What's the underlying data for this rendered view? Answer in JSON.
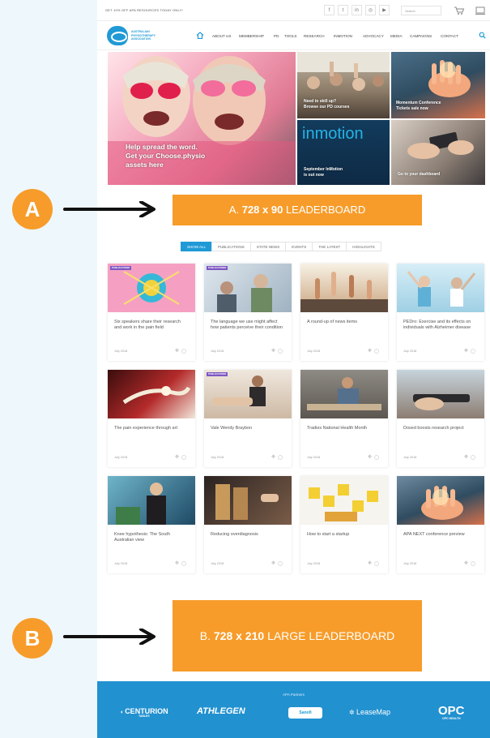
{
  "topbar": {
    "text": "GET 10% OFF APA RESOURCES TODAY ONLY!",
    "search_placeholder": "Search",
    "social_icons": [
      "facebook-icon",
      "twitter-icon",
      "linkedin-icon",
      "instagram-icon",
      "youtube-icon"
    ]
  },
  "nav": {
    "logo_text": "AUSTRALIAN PHYSIOTHERAPY ASSOCIATION",
    "items": [
      "ABOUT US",
      "MEMBERSHIP",
      "PD",
      "TOOLS",
      "RESEARCH",
      "INMOTION",
      "ADVOCACY",
      "MEDIA",
      "CAMPAIGNS",
      "CONTACT"
    ]
  },
  "hero": {
    "main_caption": "Help spread the word.\nGet your Choose.physio\nassets here",
    "tile1": "Need to skill up?\nBrowse our PD courses",
    "tile2": "Momentum Conference\nTickets sale now",
    "tile3_brand": "inmotion",
    "tile3": "September InMotion\nis out now",
    "tile4": "Go to your dashboard"
  },
  "ads": {
    "a_prefix": "A.",
    "a_size": "728 x 90",
    "a_label": "LEADERBOARD",
    "b_prefix": "B.",
    "b_size": "728 x 210",
    "b_label": "LARGE LEADERBOARD"
  },
  "filters": [
    "SHOW ALL",
    "PUBLICATIONS",
    "STATE NEWS",
    "EVENTS",
    "THE LATEST",
    "HIGHLIGHTS"
  ],
  "cards": [
    {
      "tag": "PUBLICATIONS",
      "title": "Six speakers share their research and work in the pain field",
      "date": "July 2018"
    },
    {
      "tag": "PUBLICATIONS",
      "title": "The language we use might affect how patients perceive their condition",
      "date": "July 2018"
    },
    {
      "tag": "",
      "title": "A round-up of news items",
      "date": "July 2018"
    },
    {
      "tag": "",
      "title": "PEDro: Exercise and its effects on individuals with Alzheimer disease",
      "date": "July 2018"
    },
    {
      "tag": "",
      "title": "The pain experience through art",
      "date": "July 2018"
    },
    {
      "tag": "PUBLICATIONS",
      "title": "Vale Wendy Braybon",
      "date": "July 2018"
    },
    {
      "tag": "",
      "title": "Tradies National Health Month",
      "date": "July 2018"
    },
    {
      "tag": "",
      "title": "Dosed boosts research project",
      "date": "July 2018"
    },
    {
      "tag": "",
      "title": "Knee hypothesis: The South Australian view",
      "date": "July 2018"
    },
    {
      "tag": "",
      "title": "Reducing overdiagnosis",
      "date": "July 2018"
    },
    {
      "tag": "",
      "title": "How to start a startup",
      "date": "July 2018"
    },
    {
      "tag": "",
      "title": "APA NEXT conference preview",
      "date": "July 2018"
    }
  ],
  "footer": {
    "title": "APA Partners",
    "partners": [
      "CENTURION",
      "ATHLEGEN",
      "Sanofi",
      "LeaseMap",
      "OPC"
    ],
    "centurion_sub": "TABLES",
    "opc_sub": "OPC HEALTH"
  },
  "callouts": {
    "a": "A",
    "b": "B"
  },
  "colors": {
    "accent_orange": "#f79c2a",
    "brand_blue": "#1f9ad6",
    "footer_blue": "#2291d0"
  }
}
